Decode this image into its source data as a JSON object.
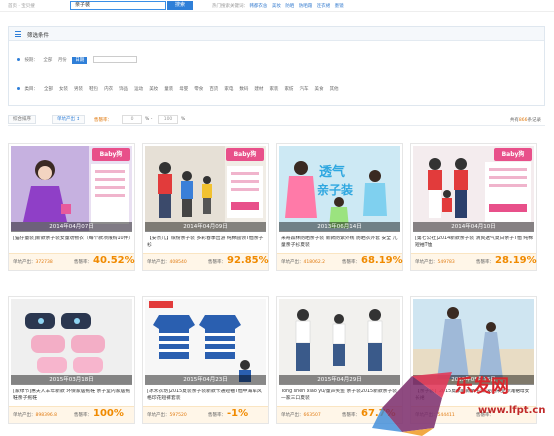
{
  "topbar": {
    "crumb": "首页 · 宝贝搜",
    "search_value": "亲子装",
    "search_button": "搜索",
    "hot_label": "热门搜索关键词：",
    "hot_keywords": [
      "韩都衣舍",
      "美妆",
      "防晒",
      "防晒霜",
      "连衣裙",
      "墨镜"
    ]
  },
  "filter": {
    "title": "筛选条件",
    "date_label": "按期：",
    "date_options": [
      "全部",
      "月份",
      "日期"
    ],
    "date_active": "日期",
    "category_label": "类目：",
    "categories": [
      "全部",
      "女装",
      "男装",
      "鞋包",
      "内衣",
      "饰品",
      "运动",
      "美妆",
      "童装",
      "母婴",
      "零食",
      "百货",
      "家电",
      "数码",
      "建材",
      "家装",
      "家纺",
      "汽车",
      "美食",
      "其他"
    ]
  },
  "sortbar": {
    "default_sort": "综合排序",
    "sales_sort": "单坑产出 ↕",
    "rate_label": "售罄率：",
    "rate_min": "0",
    "rate_sep": "% -",
    "rate_max": "100",
    "rate_unit": "%",
    "total_prefix": "共有",
    "total_count": "866",
    "total_suffix": "条记录"
  },
  "products": [
    {
      "date": "2014年04月07日",
      "title": "[猫仔童装]新款亲子装女童劝物衣（每个款项限购10件）",
      "pit_label": "单坑产出：",
      "pit_value": "372738",
      "rate_label": "售罄率：",
      "rate_value": "40.52%",
      "bg": "#d8c7e7"
    },
    {
      "date": "2014年04月09日",
      "title": "【安奈儿】缤纷亲子装 多彩春季出游 纯棉圆领T恤亲子衫",
      "pit_label": "单坑产出：",
      "pit_value": "408540",
      "rate_label": "售罄率：",
      "rate_value": "92.85%",
      "bg": "#ece7df"
    },
    {
      "date": "2013年06月14日",
      "title": "米奇森林防晒亲子装 新款防紫外线 防晒衣外套 安全 儿童亲子衫夏装",
      "pit_label": "单坑产出：",
      "pit_value": "418062.2",
      "rate_label": "售罄率：",
      "rate_value": "68.19%",
      "bg": "#c9e6f2"
    },
    {
      "date": "2014年04月10日",
      "title": "[第七公社]2014新款亲子装 清爽透气夏日亲子T恤 纯棉短袖T恤",
      "pit_label": "单坑产出：",
      "pit_value": "549783",
      "rate_label": "售罄率：",
      "rate_value": "28.19%",
      "bg": "#f3e8ea"
    },
    {
      "date": "2015年03月18日",
      "title": "[家绿节]惠夫人羊年新款 环保家居拖鞋 亲子室内家居拖鞋亲子拖鞋",
      "pit_label": "单坑产出：",
      "pit_value": "898396.8",
      "rate_label": "售罄率：",
      "rate_value": "100%",
      "bg": "#eeeeee"
    },
    {
      "date": "2015年04月23日",
      "title": "[冰禾衣坊]2015夏装亲子装新款卡通短袖T恤中海军风格印花短裤套装",
      "pit_label": "单坑产出：",
      "pit_value": "597520",
      "rate_label": "售罄率：",
      "rate_value": "-1%",
      "bg": "#f5f5f5"
    },
    {
      "date": "2015年04月29日",
      "title": "Tong shen xiao yu/童声笑鱼 亲子装2015新款亲子装一家三口夏装",
      "pit_label": "单坑产出：",
      "pit_value": "663507",
      "rate_label": "售罄率：",
      "rate_value": "67.7%",
      "bg": "#f0f0ee"
    },
    {
      "date": "2015年05月16日",
      "title": "【亲子装】2015夏季新款亲子装 波西米亚沙滩裙母女长裙",
      "pit_label": "单坑产出：",
      "pit_value": "544411",
      "rate_label": "售罄率：",
      "rate_value": "",
      "bg": "#cfe3ee"
    }
  ],
  "watermark": {
    "text": "乐发网",
    "url": "www.lfpt.cn"
  },
  "colors": {
    "accent": "#2f7fd8",
    "orange": "#f08a00",
    "pink": "#e8508a"
  }
}
